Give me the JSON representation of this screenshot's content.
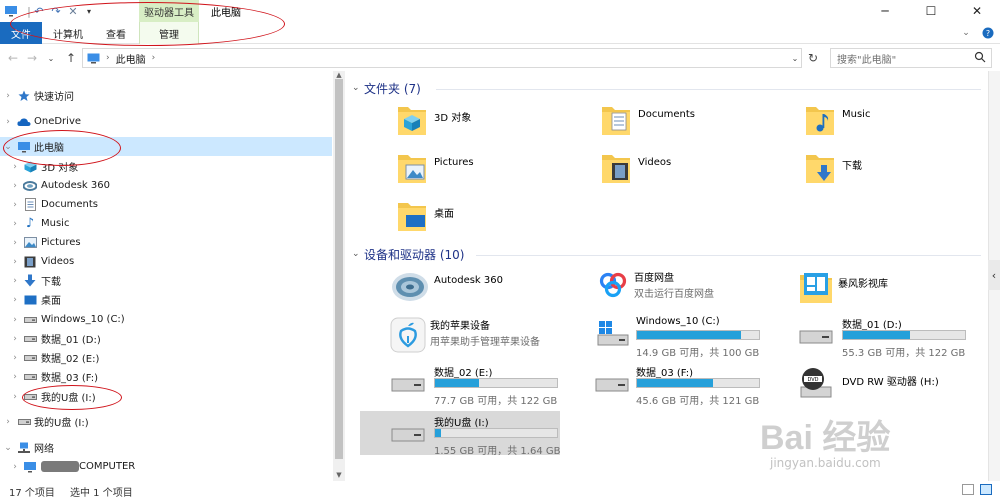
{
  "ribbon": {
    "context_tab": "驱动器工具",
    "window_title": "此电脑",
    "tabs": [
      {
        "label": "文件"
      },
      {
        "label": "计算机"
      },
      {
        "label": "查看"
      },
      {
        "label": "管理"
      }
    ]
  },
  "address": {
    "path": "此电脑",
    "search_placeholder": "搜索\"此电脑\""
  },
  "nav": {
    "quick_access": "快速访问",
    "onedrive": "OneDrive",
    "this_pc": "此电脑",
    "pc_items": [
      "3D 对象",
      "Autodesk 360",
      "Documents",
      "Music",
      "Pictures",
      "Videos",
      "下载",
      "桌面",
      "Windows_10 (C:)",
      "数据_01 (D:)",
      "数据_02 (E:)",
      "数据_03 (F:)",
      "我的U盘 (I:)"
    ],
    "usb_root": "我的U盘 (I:)",
    "network": "网络",
    "network_computer": "COMPUTER"
  },
  "content": {
    "folders_header": "文件夹 (7)",
    "folders": [
      "3D 对象",
      "Documents",
      "Music",
      "Pictures",
      "Videos",
      "下载",
      "桌面"
    ],
    "devices_header": "设备和驱动器 (10)",
    "apps": [
      {
        "name": "Autodesk 360",
        "sub": ""
      },
      {
        "name": "百度网盘",
        "sub": "双击运行百度网盘"
      },
      {
        "name": "暴风影视库",
        "sub": ""
      },
      {
        "name": "我的苹果设备",
        "sub": "用苹果助手管理苹果设备"
      }
    ],
    "drives": [
      {
        "name": "Windows_10 (C:)",
        "free": "14.9 GB 可用，共 100 GB",
        "used_fraction": 0.85
      },
      {
        "name": "数据_01 (D:)",
        "free": "55.3 GB 可用，共 122 GB",
        "used_fraction": 0.55
      },
      {
        "name": "数据_02 (E:)",
        "free": "77.7 GB 可用，共 122 GB",
        "used_fraction": 0.36
      },
      {
        "name": "数据_03 (F:)",
        "free": "45.6 GB 可用，共 121 GB",
        "used_fraction": 0.62
      },
      {
        "name": "DVD RW 驱动器 (H:)",
        "free": ""
      },
      {
        "name": "我的U盘 (I:)",
        "free": "1.55 GB 可用，共 1.64 GB",
        "used_fraction": 0.05
      }
    ]
  },
  "status": {
    "items": "17 个项目",
    "selected": "选中 1 个项目"
  },
  "watermark": {
    "brand": "Bai 经验",
    "url": "jingyan.baidu.com"
  },
  "colors": {
    "accent": "#1a6bbf",
    "selection": "#cce8ff",
    "bar_fill": "#26a0da",
    "annotation": "#d0141b"
  }
}
